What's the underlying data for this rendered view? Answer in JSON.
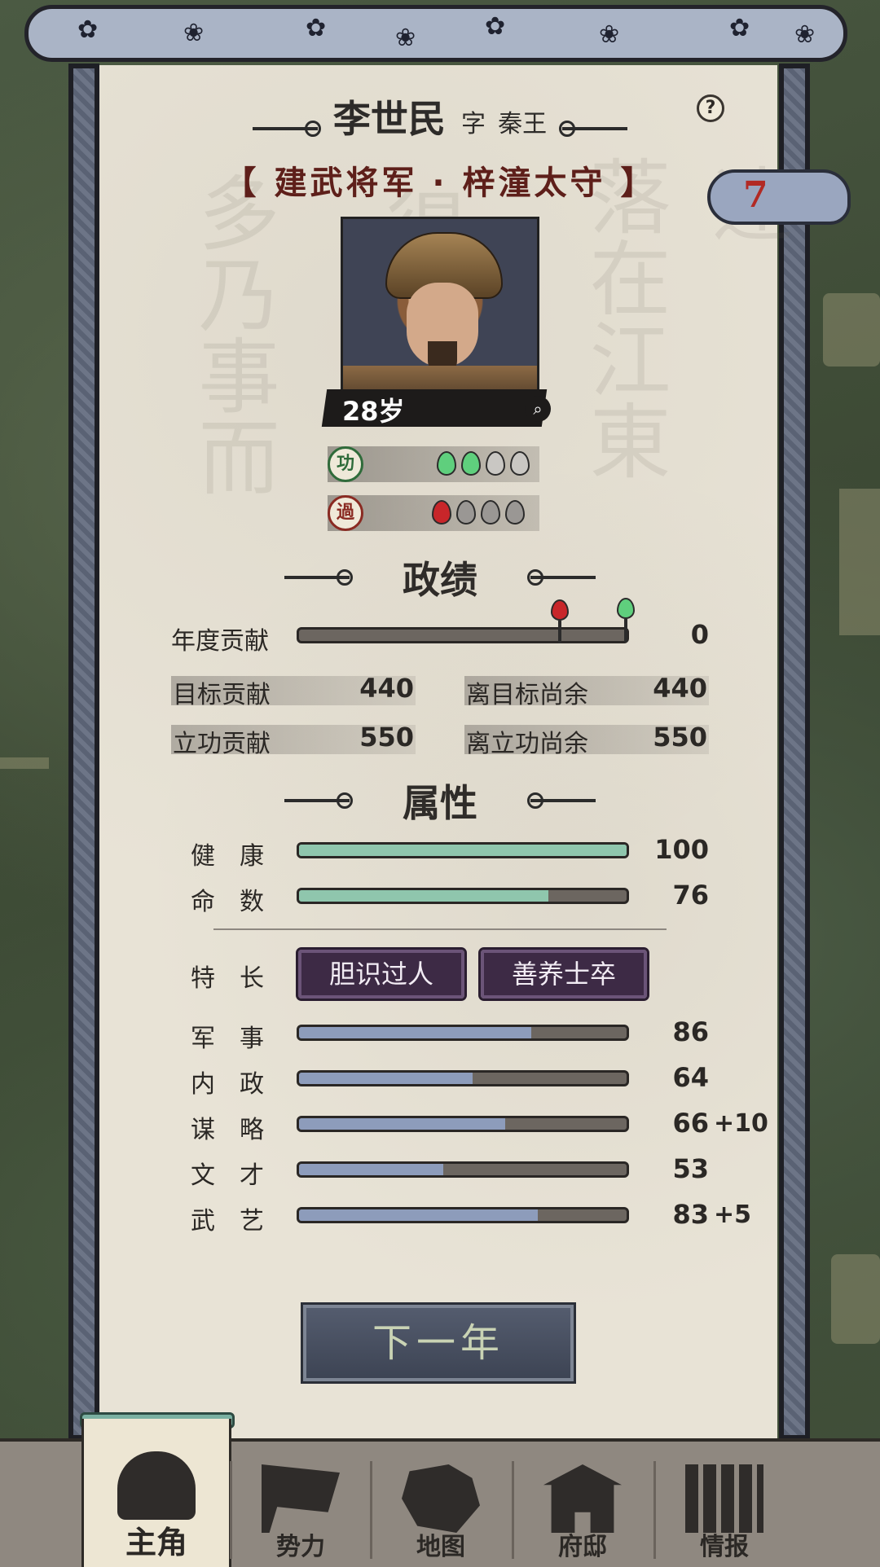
{
  "character": {
    "name": "李世民",
    "zi_label": "字",
    "zi": "秦王",
    "office": "【 建武将军 · 梓潼太守 】",
    "age": "28岁",
    "cloud_number": "7"
  },
  "merit": {
    "gong_label": "功",
    "guo_label": "過",
    "gong_filled": 2,
    "gong_total": 4,
    "guo_filled": 1,
    "guo_total": 4
  },
  "performance": {
    "heading": "政绩",
    "annual_label": "年度贡献",
    "annual_value": "0",
    "annual_fill": 0,
    "target_label": "目标贡献",
    "target_value": "440",
    "remain_target_label": "离目标尚余",
    "remain_target_value": "440",
    "merit_label": "立功贡献",
    "merit_value": "550",
    "remain_merit_label": "离立功尚余",
    "remain_merit_value": "550"
  },
  "attributes": {
    "heading": "属性",
    "health": {
      "label": "健　康",
      "value": "100",
      "fill": 1.0
    },
    "fate": {
      "label": "命　数",
      "value": "76",
      "fill": 0.76
    },
    "traits_label": "特　长",
    "traits": [
      "胆识过人",
      "善养士卒"
    ],
    "stats": [
      {
        "label": "军　事",
        "value": "86",
        "bonus": "",
        "fill": 0.71
      },
      {
        "label": "内　政",
        "value": "64",
        "bonus": "",
        "fill": 0.53
      },
      {
        "label": "谋　略",
        "value": "66",
        "bonus": "+10",
        "fill": 0.63
      },
      {
        "label": "文　才",
        "value": "53",
        "bonus": "",
        "fill": 0.44
      },
      {
        "label": "武　艺",
        "value": "83",
        "bonus": "+5",
        "fill": 0.73
      }
    ]
  },
  "next_year_label": "下一年",
  "nav": [
    {
      "label": "主角",
      "icon": "protagonist-icon",
      "active": true
    },
    {
      "label": "势力",
      "icon": "faction-flag-icon",
      "active": false
    },
    {
      "label": "地图",
      "icon": "map-icon",
      "active": false
    },
    {
      "label": "府邸",
      "icon": "mansion-icon",
      "active": false
    },
    {
      "label": "情报",
      "icon": "intel-scroll-icon",
      "active": false
    }
  ],
  "colors": {
    "health_fill": "#8fc6ad",
    "stat_fill": "#8d9cbb",
    "merit_green": "#5fcf7d",
    "fault_red": "#c8262a",
    "office_text": "#5e1f1a"
  }
}
